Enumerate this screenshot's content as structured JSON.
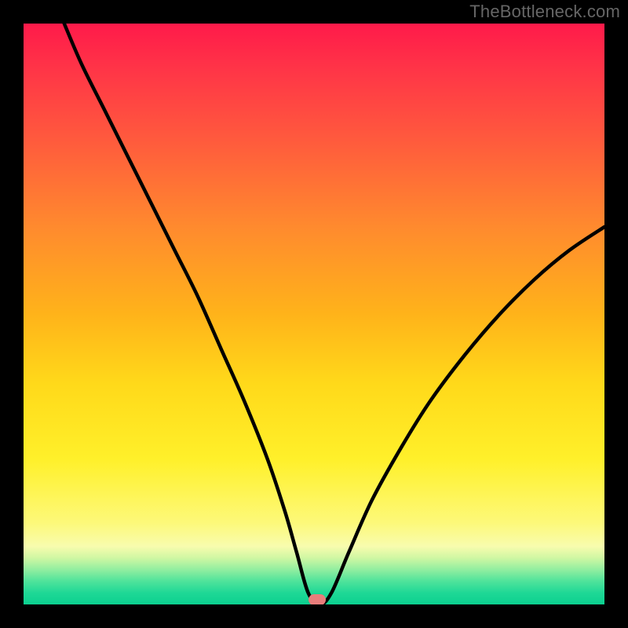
{
  "watermark": "TheBottleneck.com",
  "colors": {
    "background": "#000000",
    "gradient_top": "#ff1a4a",
    "gradient_bottom": "#0bd08f",
    "curve": "#000000",
    "marker": "#e97d7b",
    "watermark_text": "#666666"
  },
  "marker": {
    "x_pct": 50.5,
    "y_pct": 99.2
  },
  "chart_data": {
    "type": "line",
    "title": "",
    "xlabel": "",
    "ylabel": "",
    "xlim": [
      0,
      100
    ],
    "ylim": [
      0,
      100
    ],
    "x": [
      7,
      10,
      14,
      18,
      22,
      26,
      30,
      34,
      38,
      42,
      45,
      47,
      49,
      51,
      53,
      56,
      60,
      65,
      70,
      76,
      82,
      88,
      94,
      100
    ],
    "y": [
      100,
      93,
      85,
      77,
      69,
      61,
      53,
      44,
      35,
      25,
      16,
      9,
      2,
      0,
      2,
      9,
      18,
      27,
      35,
      43,
      50,
      56,
      61,
      65
    ],
    "series": [
      {
        "name": "bottleneck-curve",
        "x_key": "x",
        "y_key": "y"
      }
    ],
    "annotations": [
      {
        "type": "marker",
        "x": 50.5,
        "y": 0.8,
        "label": "optimal-point"
      }
    ]
  }
}
